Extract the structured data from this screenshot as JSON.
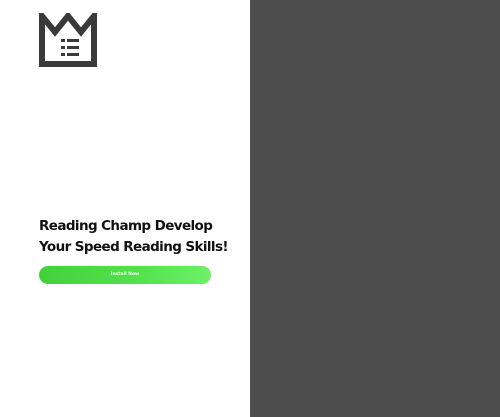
{
  "brand": {
    "logo_icon": "crown-book-icon"
  },
  "hero": {
    "headline_line1": "Reading Champ Develop",
    "headline_line2": "Your Speed Reading Skills!"
  },
  "cta": {
    "install_label": "Install Now"
  },
  "colors": {
    "left_background": "#ffffff",
    "right_background": "#4d4d4d",
    "logo": "#3a3a3a",
    "headline_text": "#111111",
    "button_gradient_start": "#43d13b",
    "button_gradient_end": "#6ef068",
    "button_text": "#ffffff"
  }
}
